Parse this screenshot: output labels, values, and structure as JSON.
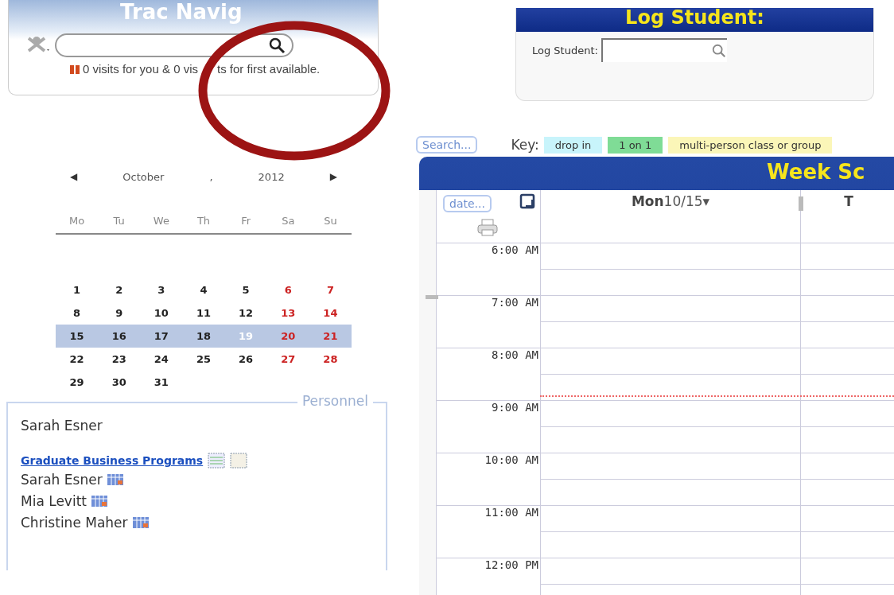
{
  "trac_navigation": {
    "title": "Trac Navig",
    "status": [
      "0 visits for you & 0 vis",
      "ts for first available."
    ]
  },
  "log_student": {
    "title": "Log Student:",
    "label": "Log Student:"
  },
  "search_button": "Search...",
  "key": {
    "label": "Key:",
    "items": [
      {
        "label": "drop in",
        "color": "#c8f4fb"
      },
      {
        "label": "1 on 1",
        "color": "#7fdc96"
      },
      {
        "label": "multi-person class or group",
        "color": "#fbf6b8"
      }
    ]
  },
  "calendar": {
    "previous": "◀",
    "next": "▶",
    "month": "October",
    "separator": ",",
    "year": "2012",
    "weekdays": [
      "Mo",
      "Tu",
      "We",
      "Th",
      "Fr",
      "Sa",
      "Su"
    ],
    "weeks": [
      {
        "selected": false,
        "days": [
          {
            "day": "1",
            "weekend": false,
            "today": false
          },
          {
            "day": "2",
            "weekend": false,
            "today": false
          },
          {
            "day": "3",
            "weekend": false,
            "today": false
          },
          {
            "day": "4",
            "weekend": false,
            "today": false
          },
          {
            "day": "5",
            "weekend": false,
            "today": false
          },
          {
            "day": "6",
            "weekend": true,
            "today": false
          },
          {
            "day": "7",
            "weekend": true,
            "today": false
          }
        ]
      },
      {
        "selected": false,
        "days": [
          {
            "day": "8",
            "weekend": false,
            "today": false
          },
          {
            "day": "9",
            "weekend": false,
            "today": false
          },
          {
            "day": "10",
            "weekend": false,
            "today": false
          },
          {
            "day": "11",
            "weekend": false,
            "today": false
          },
          {
            "day": "12",
            "weekend": false,
            "today": false
          },
          {
            "day": "13",
            "weekend": true,
            "today": false
          },
          {
            "day": "14",
            "weekend": true,
            "today": false
          }
        ]
      },
      {
        "selected": true,
        "days": [
          {
            "day": "15",
            "weekend": false,
            "today": false
          },
          {
            "day": "16",
            "weekend": false,
            "today": false
          },
          {
            "day": "17",
            "weekend": false,
            "today": false
          },
          {
            "day": "18",
            "weekend": false,
            "today": false
          },
          {
            "day": "19",
            "weekend": false,
            "today": true
          },
          {
            "day": "20",
            "weekend": true,
            "today": false
          },
          {
            "day": "21",
            "weekend": true,
            "today": false
          }
        ]
      },
      {
        "selected": false,
        "days": [
          {
            "day": "22",
            "weekend": false,
            "today": false
          },
          {
            "day": "23",
            "weekend": false,
            "today": false
          },
          {
            "day": "24",
            "weekend": false,
            "today": false
          },
          {
            "day": "25",
            "weekend": false,
            "today": false
          },
          {
            "day": "26",
            "weekend": false,
            "today": false
          },
          {
            "day": "27",
            "weekend": true,
            "today": false
          },
          {
            "day": "28",
            "weekend": true,
            "today": false
          }
        ]
      },
      {
        "selected": false,
        "days": [
          {
            "day": "29",
            "weekend": false,
            "today": false
          },
          {
            "day": "30",
            "weekend": false,
            "today": false
          },
          {
            "day": "31",
            "weekend": false,
            "today": false
          }
        ]
      }
    ]
  },
  "personnel": {
    "legend": "Personnel",
    "user": "Sarah Esner",
    "group": "Graduate Business Programs",
    "people": [
      "Sarah Esner",
      "Mia Levitt",
      "Christine Maher"
    ]
  },
  "schedule": {
    "title": "Week Sc",
    "date_button": "date...",
    "columns": [
      {
        "day": "Mon",
        "date": "10/15",
        "menu": "▾"
      },
      {
        "day": "T"
      }
    ],
    "times": [
      "6:00 AM",
      "7:00 AM",
      "8:00 AM",
      "9:00 AM",
      "10:00 AM",
      "11:00 AM",
      "12:00 PM"
    ]
  }
}
